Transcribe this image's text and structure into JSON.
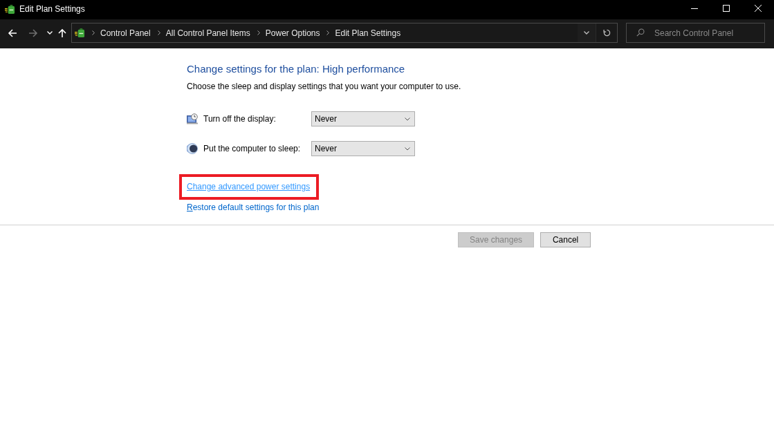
{
  "window": {
    "title": "Edit Plan Settings"
  },
  "navigation": {
    "back": {
      "disabled": false
    },
    "forward": {
      "disabled": true
    }
  },
  "address_bar": {
    "breadcrumbs": [
      "Control Panel",
      "All Control Panel Items",
      "Power Options",
      "Edit Plan Settings"
    ]
  },
  "search": {
    "placeholder": "Search Control Panel"
  },
  "heading": "Change settings for the plan: High performance",
  "description": "Choose the sleep and display settings that you want your computer to use.",
  "settings": [
    {
      "kind": "display",
      "label": "Turn off the display:",
      "value": "Never"
    },
    {
      "kind": "sleep",
      "label": "Put the computer to sleep:",
      "value": "Never"
    }
  ],
  "links": [
    {
      "label": "Change advanced power settings",
      "highlighted": true
    },
    {
      "label": "Restore default settings for this plan",
      "highlighted": false
    }
  ],
  "buttons": [
    {
      "label": "Save changes",
      "disabled": true
    },
    {
      "label": "Cancel",
      "disabled": false
    }
  ]
}
